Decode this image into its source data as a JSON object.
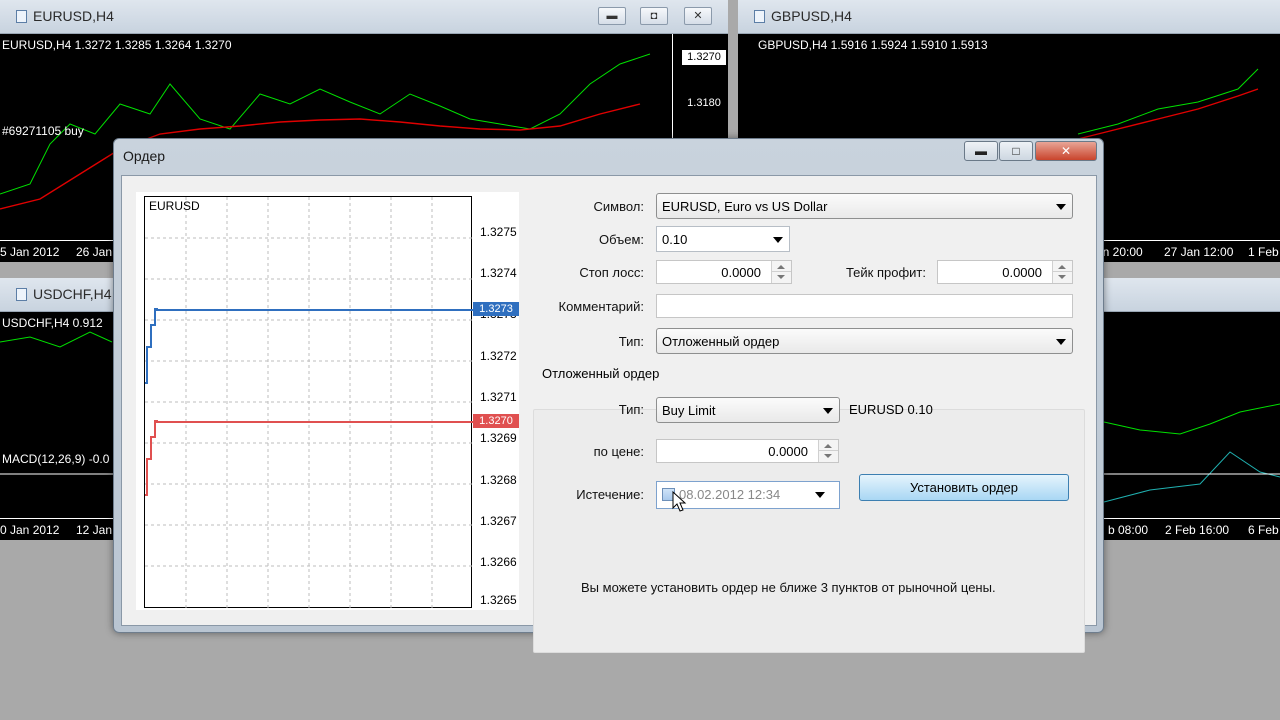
{
  "windows": {
    "eurusd": {
      "title": "EURUSD,H4",
      "info": "EURUSD,H4  1.3272 1.3285 1.3264 1.3270",
      "trade_label": "#69271105 buy",
      "price_tag": "1.3270",
      "price_level": "1.3180",
      "dates": [
        "5 Jan 2012",
        "26 Jan"
      ]
    },
    "gbpusd": {
      "title": "GBPUSD,H4",
      "info": "GBPUSD,H4  1.5916 1.5924 1.5910 1.5913",
      "dates": [
        "an 20:00",
        "27 Jan 12:00",
        "1 Feb"
      ]
    },
    "usdchf": {
      "title": "USDCHF,H4",
      "info": "USDCHF,H4  0.912",
      "indicator": "MACD(12,26,9) -0.0",
      "dates": [
        "0 Jan 2012",
        "12 Jan"
      ]
    },
    "right_bottom_dates": [
      "b 08:00",
      "2 Feb 16:00",
      "6 Feb"
    ],
    "buttons": [
      "▬",
      "◘",
      "✕"
    ]
  },
  "dialog": {
    "title": "Ордер",
    "title_buttons": [
      "▬",
      "□",
      "✕"
    ],
    "chart": {
      "symbol": "EURUSD",
      "price_labels": [
        "1.3275",
        "1.3274",
        "1.3273",
        "1.3272",
        "1.3271",
        "1.3269",
        "1.3268",
        "1.3267",
        "1.3266",
        "1.3265"
      ],
      "ask_tag": "1.3273",
      "bid_tag": "1.3270",
      "colors": {
        "ask": "#2f6fbf",
        "bid": "#e05050"
      }
    },
    "form": {
      "symbol_label": "Символ:",
      "symbol_value": "EURUSD, Euro vs US Dollar",
      "volume_label": "Объем:",
      "volume_value": "0.10",
      "sl_label": "Стоп лосс:",
      "sl_value": "0.0000",
      "tp_label": "Тейк профит:",
      "tp_value": "0.0000",
      "comment_label": "Комментарий:",
      "comment_value": "",
      "type_label": "Тип:",
      "type_value": "Отложенный ордер"
    },
    "pending": {
      "group_title": "Отложенный ордер",
      "type_label": "Тип:",
      "type_value": "Buy Limit",
      "type_info": "EURUSD 0.10",
      "price_label": "по цене:",
      "price_value": "0.0000",
      "submit_label": "Установить ордер",
      "expiry_label": "Истечение:",
      "expiry_value": "08.02.2012 12:34",
      "expiry_checked": false,
      "note": "Вы можете установить ордер не ближе 3 пунктов от рыночной цены."
    }
  }
}
